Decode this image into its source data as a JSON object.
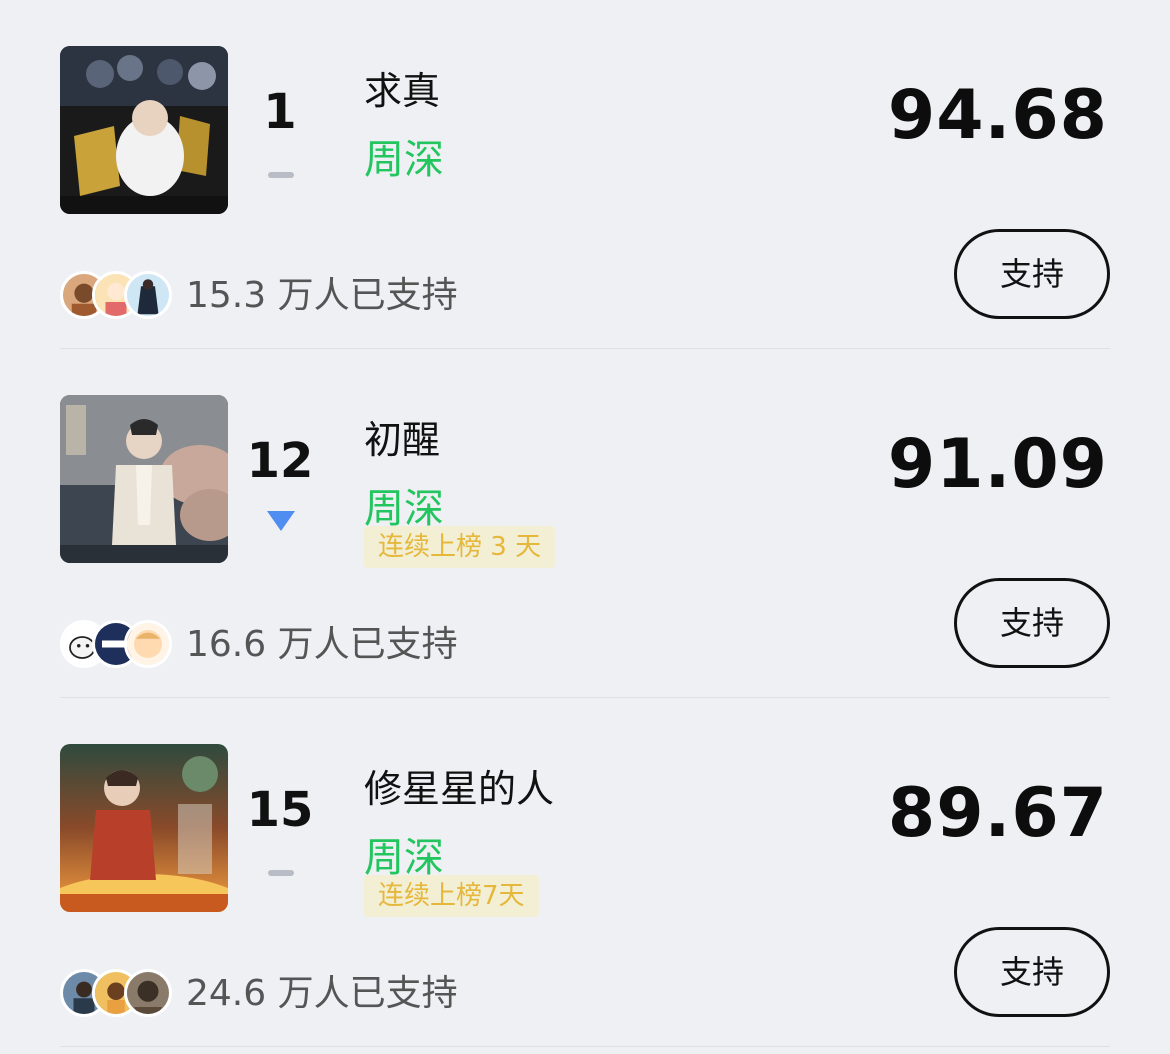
{
  "items": [
    {
      "rank": "1",
      "trend": "flat",
      "song": "求真",
      "artist": "周深",
      "streak": "",
      "score": "94.68",
      "supporters": "15.3 万人已支持",
      "support_label": "支持",
      "cover_colors": [
        "#1a1a1a",
        "#c9a23a",
        "#f2f2f2"
      ],
      "avatar_colors": [
        [
          "#d9a77b",
          "#7a4b2a"
        ],
        [
          "#fbe3b5",
          "#e26a6a"
        ],
        [
          "#cfe7f5",
          "#1e2a3a"
        ]
      ]
    },
    {
      "rank": "12",
      "trend": "down",
      "song": "初醒",
      "artist": "周深",
      "streak": "连续上榜 3 天",
      "score": "91.09",
      "supporters": "16.6 万人已支持",
      "support_label": "支持",
      "cover_colors": [
        "#3d4650",
        "#c8b6a4",
        "#e9e2d6"
      ],
      "avatar_colors": [
        [
          "#ffffff",
          "#222222"
        ],
        [
          "#1f2f5c",
          "#ffffff"
        ],
        [
          "#ffd9b0",
          "#e9b36a"
        ]
      ]
    },
    {
      "rank": "15",
      "trend": "flat",
      "song": "修星星的人",
      "artist": "周深",
      "streak": "连续上榜7天",
      "score": "89.67",
      "supporters": "24.6 万人已支持",
      "support_label": "支持",
      "cover_colors": [
        "#2f4a3e",
        "#d46a2a",
        "#f7c65a"
      ],
      "avatar_colors": [
        [
          "#6d8aa8",
          "#3a2b22"
        ],
        [
          "#f0c060",
          "#6a4020"
        ],
        [
          "#8a7a6a",
          "#3a3025"
        ]
      ]
    }
  ]
}
